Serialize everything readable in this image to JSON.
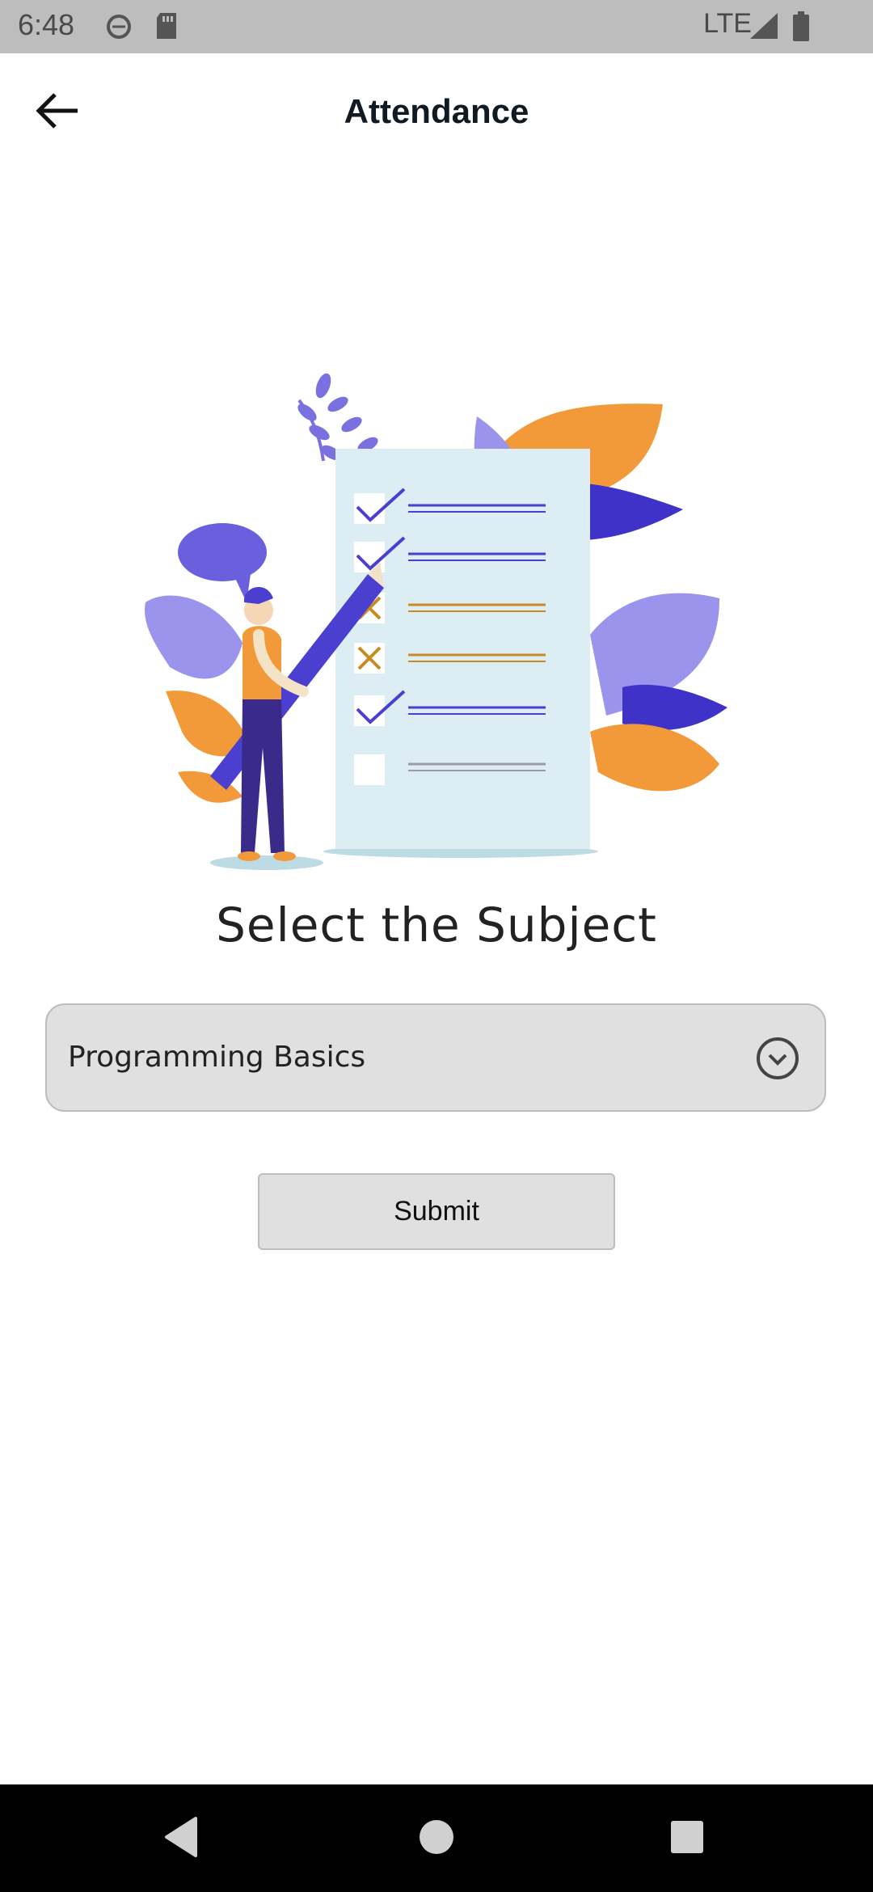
{
  "status_bar": {
    "time": "6:48",
    "network": "LTE",
    "icons": [
      "sync-icon",
      "sd-card-icon",
      "signal-icon",
      "battery-icon"
    ]
  },
  "app_bar": {
    "title": "Attendance",
    "back_icon": "arrow-left-icon"
  },
  "main": {
    "prompt": "Select the Subject",
    "subject_select": {
      "selected": "Programming Basics",
      "icon": "chevron-down-circle-icon"
    },
    "submit_label": "Submit"
  },
  "nav_bar": {
    "icons": [
      "back-triangle-icon",
      "home-circle-icon",
      "recents-square-icon"
    ]
  },
  "colors": {
    "accent_purple": "#4b3fcf",
    "light_purple": "#9a94ec",
    "orange": "#f29a3a",
    "checklist_bg": "#dcedf4"
  }
}
